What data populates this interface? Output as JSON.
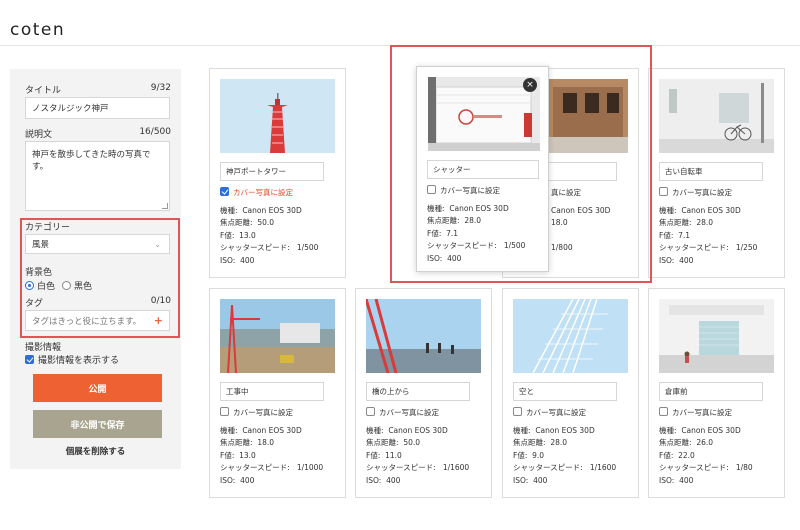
{
  "app": {
    "logo": "coten"
  },
  "sidebar": {
    "title_label": "タイトル",
    "title_count": "9/32",
    "title_value": "ノスタルジック神戸",
    "desc_label": "説明文",
    "desc_count": "16/500",
    "desc_value": "神戸を散歩してきた時の写真です。",
    "category_label": "カテゴリー",
    "category_value": "風景",
    "bg_label": "背景色",
    "bg_options": [
      "白色",
      "黒色"
    ],
    "bg_selected": "白色",
    "tag_label": "タグ",
    "tag_count": "0/10",
    "tag_placeholder": "タグはきっと役に立ちます。",
    "exif_label": "撮影情報",
    "exif_checkbox": "撮影情報を表示する",
    "publish_button": "公開",
    "private_button": "非公開で保存",
    "delete_link": "個展を削除する"
  },
  "labels": {
    "cover": "カバー写真に設定",
    "camera": "機種:",
    "focal": "焦点距離:",
    "fnum": "F値:",
    "shutter": "シャッタースピード:",
    "iso": "ISO:"
  },
  "photos": [
    {
      "title": "神戸ポートタワー",
      "cover": true,
      "camera": "Canon EOS 30D",
      "focal": "50.0",
      "fnum": "13.0",
      "shutter": "1/500",
      "iso": "400"
    },
    {
      "title": "",
      "cover": false,
      "cover_partial": "真に設定",
      "camera": "Canon EOS 30D",
      "focal": "18.0",
      "fnum": "",
      "shutter": "1/800",
      "iso": ""
    },
    {
      "title": "古い自転車",
      "cover": false,
      "camera": "Canon EOS 30D",
      "focal": "28.0",
      "fnum": "7.1",
      "shutter": "1/250",
      "iso": "400"
    },
    {
      "title": "工事中",
      "cover": false,
      "camera": "Canon EOS 30D",
      "focal": "18.0",
      "fnum": "13.0",
      "shutter": "1/1000",
      "iso": "400"
    },
    {
      "title": "橋の上から",
      "cover": false,
      "camera": "Canon EOS 30D",
      "focal": "50.0",
      "fnum": "11.0",
      "shutter": "1/1600",
      "iso": "400"
    },
    {
      "title": "空と",
      "cover": false,
      "camera": "Canon EOS 30D",
      "focal": "28.0",
      "fnum": "9.0",
      "shutter": "1/1600",
      "iso": "400"
    },
    {
      "title": "倉庫前",
      "cover": false,
      "camera": "Canon EOS 30D",
      "focal": "26.0",
      "fnum": "22.0",
      "shutter": "1/80",
      "iso": "400"
    }
  ],
  "popup": {
    "title": "シャッター",
    "cover": false,
    "camera": "Canon EOS 30D",
    "focal": "28.0",
    "fnum": "7.1",
    "shutter": "1/500",
    "iso": "400",
    "close": "×"
  },
  "colors": {
    "accent": "#ee6133",
    "highlight": "#e05555",
    "secondary_button": "#a8a48f",
    "link_blue": "#2b6fd6"
  }
}
